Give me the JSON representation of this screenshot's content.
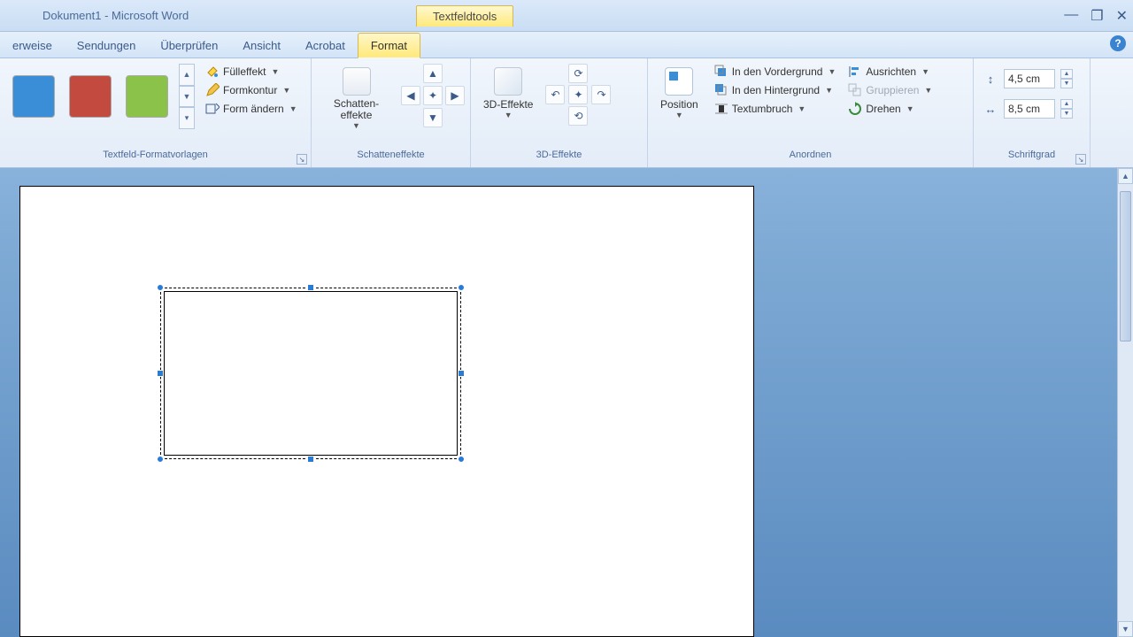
{
  "window": {
    "title": "Dokument1 - Microsoft Word",
    "contextual_tab": "Textfeldtools"
  },
  "tabs": {
    "verweise": "erweise",
    "sendungen": "Sendungen",
    "ueberpruefen": "Überprüfen",
    "ansicht": "Ansicht",
    "acrobat": "Acrobat",
    "format": "Format"
  },
  "ribbon": {
    "styles": {
      "group_label": "Textfeld-Formatvorlagen",
      "fuelleffekt": "Fülleffekt",
      "formkontur": "Formkontur",
      "form_aendern": "Form ändern"
    },
    "shadow": {
      "group_label": "Schatteneffekte",
      "schatten": "Schatten-\neffekte"
    },
    "threed": {
      "group_label": "3D-Effekte",
      "label": "3D-Effekte"
    },
    "arrange": {
      "group_label": "Anordnen",
      "position": "Position",
      "vordergrund": "In den Vordergrund",
      "hintergrund": "In den Hintergrund",
      "textumbruch": "Textumbruch",
      "ausrichten": "Ausrichten",
      "gruppieren": "Gruppieren",
      "drehen": "Drehen"
    },
    "size": {
      "group_label": "Schriftgrad",
      "height": "4,5 cm",
      "width": "8,5 cm"
    }
  }
}
